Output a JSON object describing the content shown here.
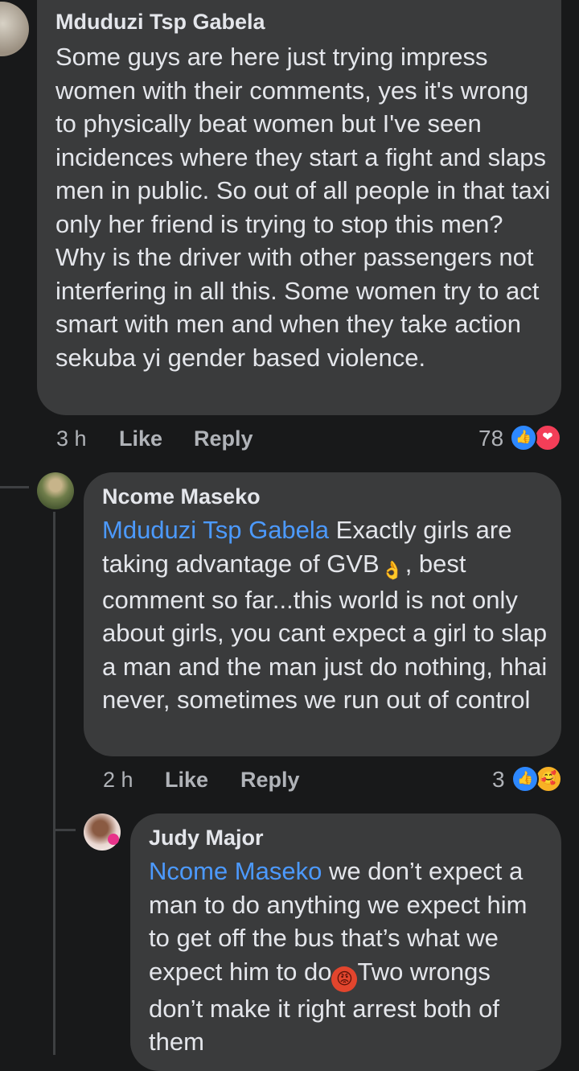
{
  "comments": [
    {
      "author": "Mduduzi Tsp Gabela",
      "text": "Some guys are here just trying impress women with their comments, yes it's wrong to physically beat women but I've seen incidences where they start a fight and slaps men in public. So out of all people in that taxi only her friend is trying to stop this men? Why is the driver with other passengers not interfering in all this. Some women try to act smart with men and when they take action sekuba yi gender based violence.",
      "time": "3 h",
      "like_label": "Like",
      "reply_label": "Reply",
      "reaction_count": "78",
      "reactions": [
        "like",
        "love"
      ]
    },
    {
      "author": "Ncome Maseko",
      "mention": "Mduduzi Tsp Gabela",
      "text_before_emoji": " Exactly girls are taking advantage of GVB",
      "emoji": "ok-hand",
      "text_after_emoji": ", best comment so far...this world is not only about girls, you cant expect a girl to slap a man and the man just do nothing, hhai never, sometimes we run out of control",
      "time": "2 h",
      "like_label": "Like",
      "reply_label": "Reply",
      "reaction_count": "3",
      "reactions": [
        "like",
        "care"
      ]
    },
    {
      "author": "Judy Major",
      "mention": "Ncome Maseko",
      "text_before_emoji": " we don’t expect a man to do anything we expect him to get off the bus that’s what we expect him to do",
      "emoji": "angry-face",
      "text_after_emoji": "Two wrongs don’t make it right arrest both of them"
    }
  ],
  "colors": {
    "background": "#18191a",
    "bubble": "#3a3b3c",
    "mention": "#4c9aff",
    "meta": "#b0b3b8"
  }
}
